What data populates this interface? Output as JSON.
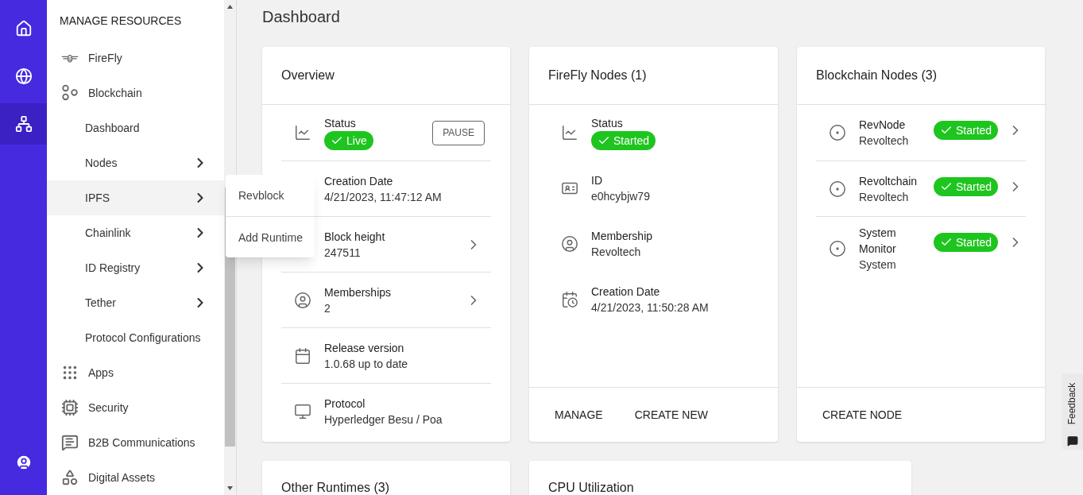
{
  "rail": [
    {
      "selected": false
    },
    {
      "selected": false
    },
    {
      "selected": true
    }
  ],
  "sidebar": {
    "heading": "MANAGE RESOURCES",
    "items": [
      {
        "label": "FireFly",
        "selected": false
      },
      {
        "label": "Blockchain",
        "selected": false,
        "children": [
          {
            "label": "Dashboard",
            "has_submenu": false,
            "selected": false
          },
          {
            "label": "Nodes",
            "has_submenu": true,
            "selected": false
          },
          {
            "label": "IPFS",
            "has_submenu": true,
            "selected": true
          },
          {
            "label": "Chainlink",
            "has_submenu": true,
            "selected": false
          },
          {
            "label": "ID Registry",
            "has_submenu": true,
            "selected": false
          },
          {
            "label": "Tether",
            "has_submenu": true,
            "selected": false
          },
          {
            "label": "Protocol Configurations",
            "has_submenu": false,
            "selected": false
          }
        ]
      },
      {
        "label": "Apps",
        "selected": false
      },
      {
        "label": "Security",
        "selected": false
      },
      {
        "label": "B2B Communications",
        "selected": false
      },
      {
        "label": "Digital Assets",
        "selected": false
      }
    ]
  },
  "submenu": [
    "Revblock",
    "Add Runtime"
  ],
  "page_title": "Dashboard",
  "overview": {
    "title": "Overview",
    "action": "PAUSE",
    "rows": [
      {
        "label": "Status",
        "badge": "Live",
        "chevron": false
      },
      {
        "label": "Creation Date",
        "value": "4/21/2023, 11:47:12 AM",
        "chevron": false
      },
      {
        "label": "Block height",
        "value": "247511",
        "chevron": true
      },
      {
        "label": "Memberships",
        "value": "2",
        "chevron": true
      },
      {
        "label": "Release version",
        "value": "1.0.68 up to date",
        "chevron": false
      },
      {
        "label": "Protocol",
        "value": "Hyperledger Besu / Poa",
        "chevron": false
      }
    ]
  },
  "firefly_nodes": {
    "title": "FireFly Nodes (1)",
    "rows": [
      {
        "label": "Status",
        "badge": "Started"
      },
      {
        "label": "ID",
        "value": "e0hcybjw79"
      },
      {
        "label": "Membership",
        "value": "Revoltech"
      },
      {
        "label": "Creation Date",
        "value": "4/21/2023, 11:50:28 AM"
      }
    ],
    "actions": [
      "MANAGE",
      "CREATE NEW"
    ]
  },
  "blockchain_nodes": {
    "title": "Blockchain Nodes (3)",
    "nodes": [
      {
        "name": "RevNode",
        "owner": "Revoltech",
        "status": "Started"
      },
      {
        "name": "Revoltchain",
        "owner": "Revoltech",
        "status": "Started"
      },
      {
        "name": "System Monitor",
        "owner": "System",
        "status": "Started"
      }
    ],
    "actions": [
      "CREATE NODE"
    ]
  },
  "lower_cards": [
    "Other Runtimes (3)",
    "CPU Utilization"
  ],
  "feedback": "Feedback"
}
